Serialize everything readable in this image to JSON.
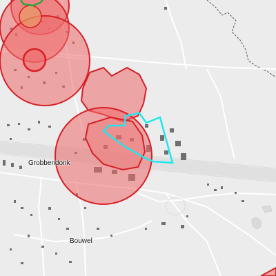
{
  "map": {
    "type": "map",
    "basemap_style": "light-grey",
    "colors": {
      "background": "#ececec",
      "road": "#ffffff",
      "road_casing": "#c8c8c8",
      "highway": "#e2e2e2",
      "building": "#6f6f6f",
      "boundary": "#555555",
      "buffer_fill": "#ee6a6a",
      "buffer_stroke": "#d81f26",
      "inner_highlight": "#e89a66",
      "green_outline": "#2fa63a",
      "site_outline": "#22e6ee"
    },
    "place_labels": [
      "Grobbendonk",
      "Bouwel"
    ]
  }
}
